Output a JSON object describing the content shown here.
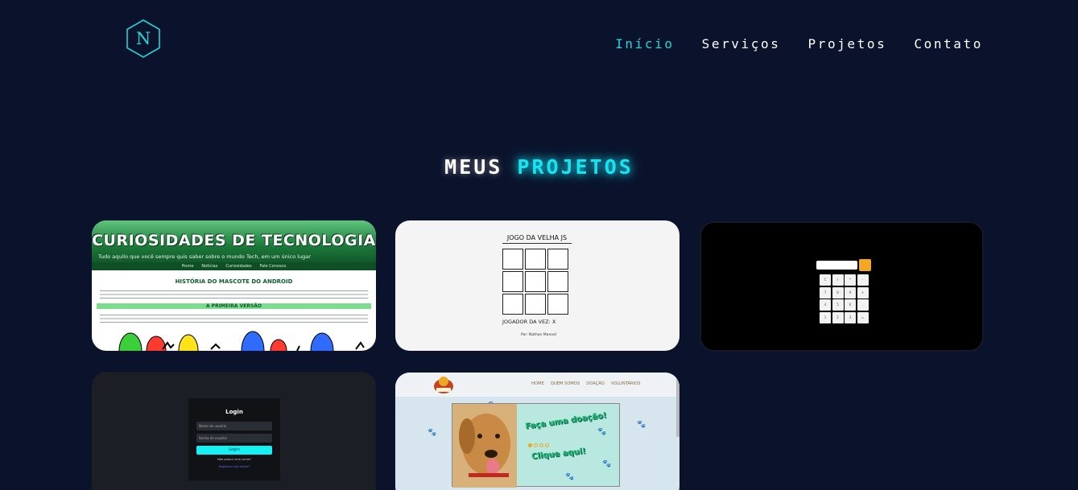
{
  "header": {
    "logo_letter": "N",
    "nav": [
      {
        "label": "Início",
        "active": true
      },
      {
        "label": "Serviços",
        "active": false
      },
      {
        "label": "Projetos",
        "active": false
      },
      {
        "label": "Contato",
        "active": false
      }
    ]
  },
  "section": {
    "title_word1": "MEUS",
    "title_word2": "PROJETOS"
  },
  "colors": {
    "background": "#0b132c",
    "accent": "#22d3d9",
    "title_accent": "#19e3f0"
  },
  "projects": [
    {
      "banner_title": "CURIOSIDADES DE TECNOLOGIA",
      "subtitle": "Tudo aquilo que você sempre quis saber sobre o mundo Tech, em um único lugar",
      "menu": [
        "Home",
        "Notícias",
        "Curiosidades",
        "Fale Conosco"
      ],
      "heading": "HISTÓRIA DO MASCOTE DO ANDROID",
      "subheading": "A PRIMEIRA VERSÃO"
    },
    {
      "title": "JOGO DA VELHA JS",
      "turn": "JOGADOR DA VEZ: X",
      "author": "Por: Nathan Manoel"
    },
    {
      "keys": [
        "C",
        "/",
        "*",
        "-",
        "7",
        "8",
        "9",
        "+",
        "4",
        "5",
        "6",
        ".",
        "1",
        "2",
        "3",
        "="
      ]
    },
    {
      "title": "Login",
      "username_placeholder": "Nome de usuário",
      "password_placeholder": "Senha do usuário",
      "button": "Login",
      "signup_text": "Não possui uma conta?",
      "forgot_text": "Esqueceu sua senha?"
    },
    {
      "nav": [
        "HOME",
        "QUEM SOMOS",
        "DOAÇÃO",
        "VOLUNTÁRIOS"
      ],
      "headline": "Faça uma doação!",
      "cta": "Clique aqui!"
    }
  ]
}
